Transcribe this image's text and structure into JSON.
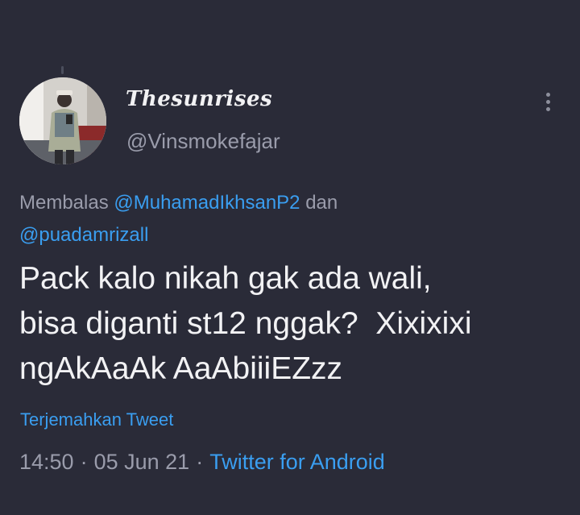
{
  "tweet": {
    "display_name": "Thesunrises",
    "handle": "@Vinsmokefajar",
    "reply": {
      "prefix": "Membalas ",
      "mention_1": "@MuhamadIkhsanP2",
      "joiner": " dan ",
      "mention_2": "@puadamrizall"
    },
    "text": "Pack kalo nikah gak ada wali,\nbisa diganti st12 nggak?  Xixixixi\nngAkAaAk AaAbiiiEZzz",
    "translate_label": "Terjemahkan Tweet",
    "time": "14:50",
    "date": "05 Jun 21",
    "separator": "·",
    "source": "Twitter for Android"
  },
  "icons": {
    "avatar": "profile-photo",
    "more": "vertical-ellipsis-icon"
  },
  "colors": {
    "background": "#2a2b38",
    "text": "#f2f2f4",
    "muted": "#9a9cab",
    "link": "#3a9ef0"
  }
}
